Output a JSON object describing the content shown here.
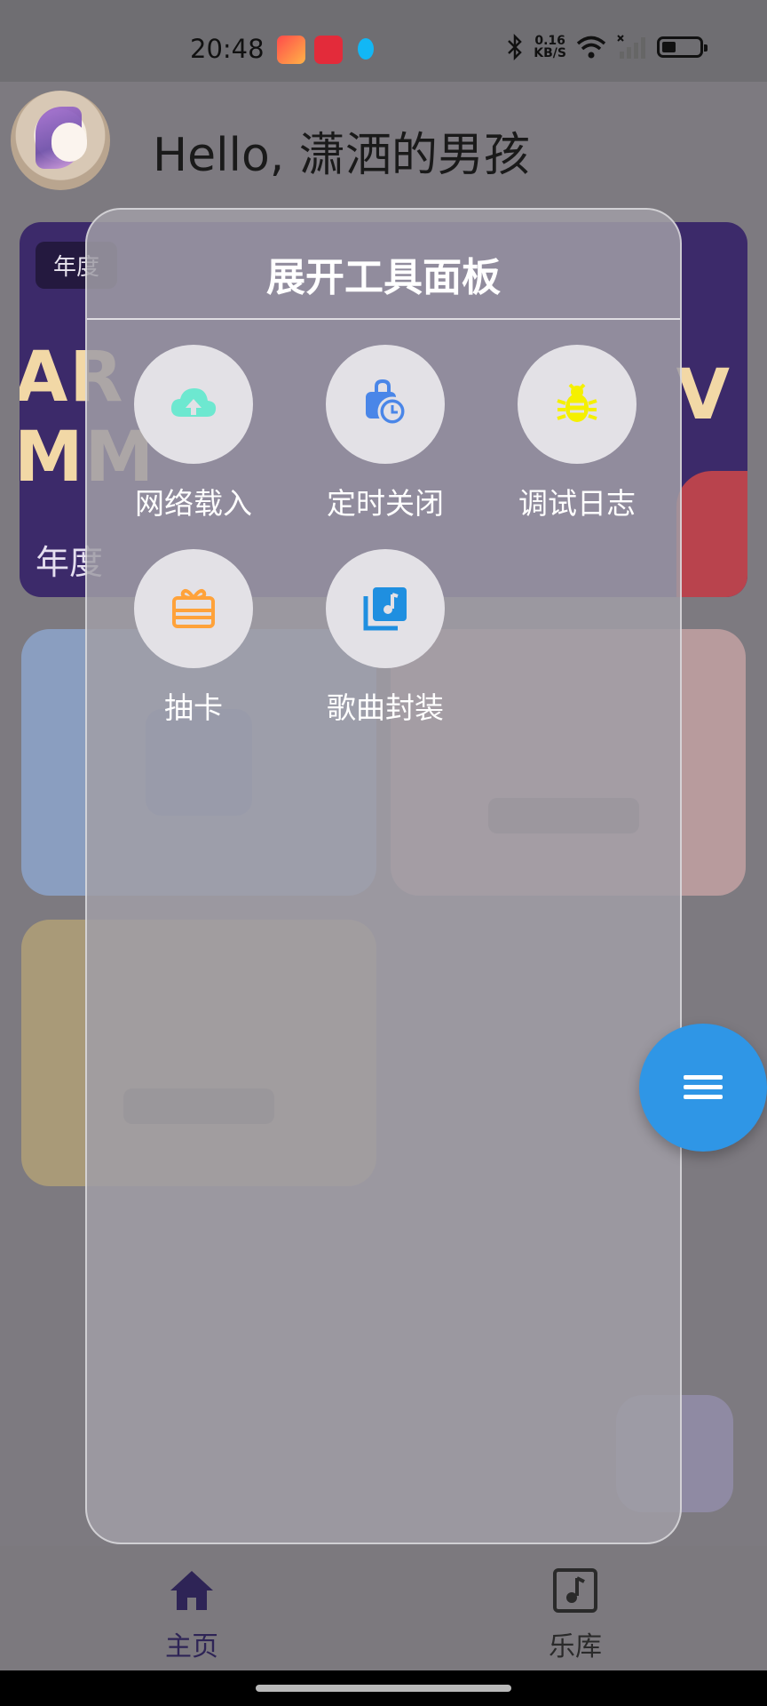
{
  "status_bar": {
    "time": "20:48",
    "net_speed_value": "0.16",
    "net_speed_unit": "KB/S"
  },
  "header": {
    "greeting": "Hello, 潇洒的男孩"
  },
  "background": {
    "banner_tag": "年度",
    "banner_text_left": "AR\nMM",
    "banner_text_right": "V",
    "banner_bottom": "年度"
  },
  "panel": {
    "title": "展开工具面板",
    "tools": [
      {
        "label": "网络载入",
        "icon": "cloud-upload-icon",
        "color": "#6de8d0"
      },
      {
        "label": "定时关闭",
        "icon": "timer-icon",
        "color": "#4a86e8"
      },
      {
        "label": "调试日志",
        "icon": "bug-icon",
        "color": "#f5f000"
      },
      {
        "label": "抽卡",
        "icon": "gift-card-icon",
        "color": "#ffa23a"
      },
      {
        "label": "歌曲封装",
        "icon": "music-library-icon",
        "color": "#1f8fe0"
      }
    ]
  },
  "fab": {
    "icon": "menu-icon",
    "color": "#2f96e6"
  },
  "bottom_nav": {
    "items": [
      {
        "label": "主页",
        "icon": "home-icon"
      },
      {
        "label": "乐库",
        "icon": "music-note-icon"
      }
    ]
  }
}
